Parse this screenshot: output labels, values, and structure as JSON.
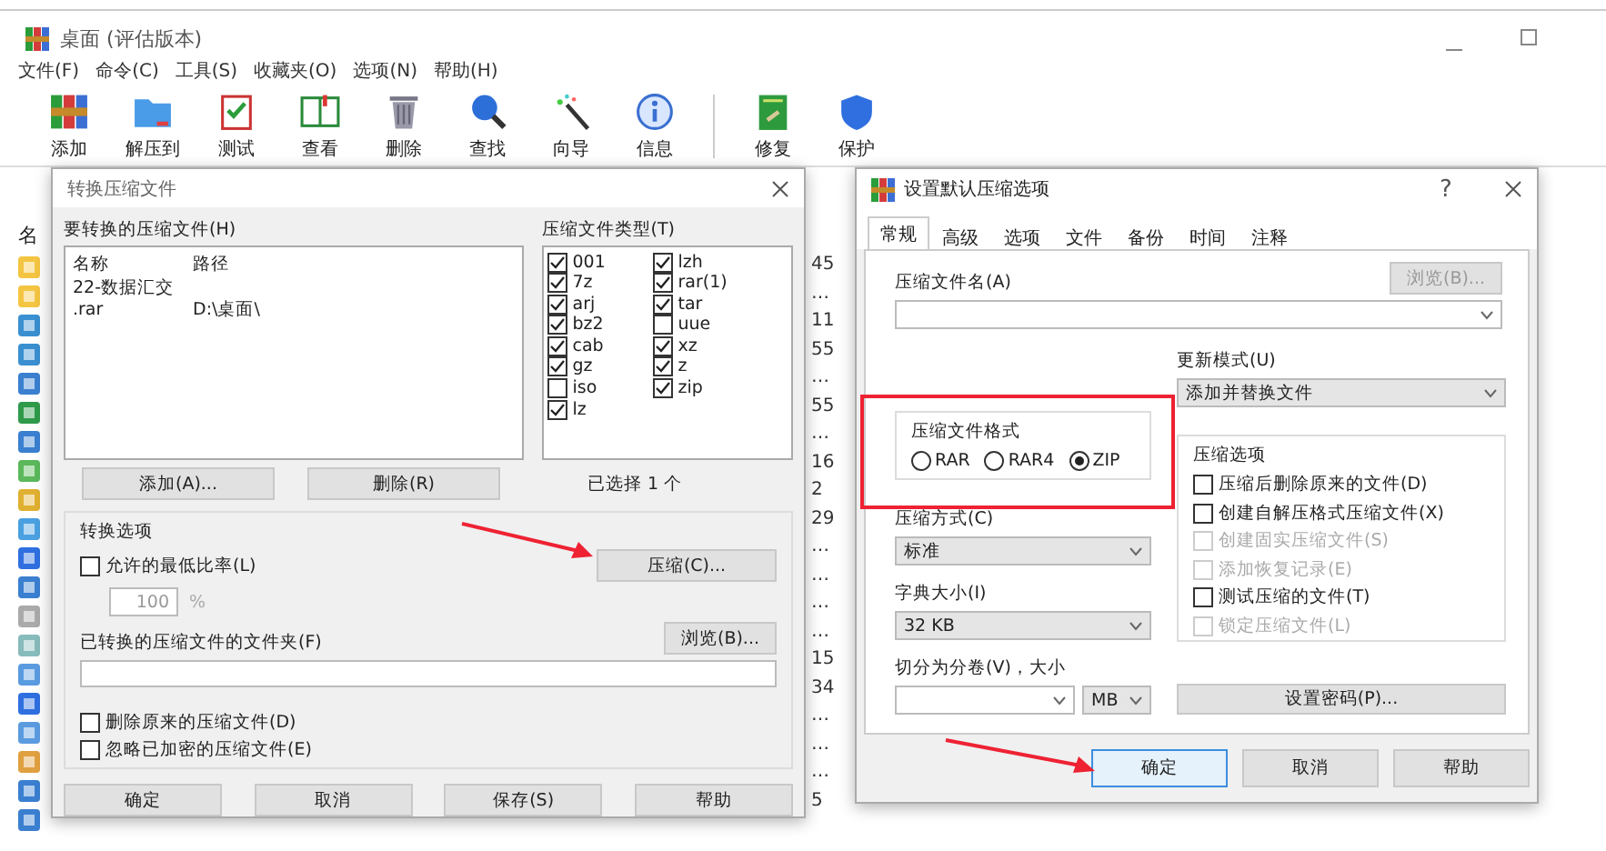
{
  "main_window": {
    "title": "桌面 (评估版本)",
    "menu": [
      "文件(F)",
      "命令(C)",
      "工具(S)",
      "收藏夹(O)",
      "选项(N)",
      "帮助(H)"
    ],
    "toolbar": [
      {
        "label": "添加"
      },
      {
        "label": "解压到"
      },
      {
        "label": "测试"
      },
      {
        "label": "查看"
      },
      {
        "label": "删除"
      },
      {
        "label": "查找"
      },
      {
        "label": "向导"
      },
      {
        "label": "信息"
      },
      {
        "label": "修复"
      },
      {
        "label": "保护"
      }
    ],
    "list_header": "名",
    "column_3": [
      "45",
      "…",
      "11",
      "55",
      "…",
      "55",
      "…",
      "16",
      "2",
      "29",
      "…",
      "…",
      "…",
      "…",
      "15",
      "34",
      "…",
      "…",
      "…",
      "5"
    ]
  },
  "convert_dialog": {
    "title": "转换压缩文件",
    "files_label": "要转换的压缩文件(H)",
    "columns": [
      "名称",
      "路径"
    ],
    "rows": [
      [
        "22-数据汇交 .rar",
        "D:\\桌面\\"
      ]
    ],
    "types_label": "压缩文件类型(T)",
    "types": [
      {
        "label": "001",
        "checked": true
      },
      {
        "label": "7z",
        "checked": true
      },
      {
        "label": "arj",
        "checked": true
      },
      {
        "label": "bz2",
        "checked": true
      },
      {
        "label": "cab",
        "checked": true
      },
      {
        "label": "gz",
        "checked": true
      },
      {
        "label": "iso",
        "checked": false
      },
      {
        "label": "lz",
        "checked": true
      },
      {
        "label": "lzh",
        "checked": true
      },
      {
        "label": "rar(1)",
        "checked": true
      },
      {
        "label": "tar",
        "checked": true
      },
      {
        "label": "uue",
        "checked": false
      },
      {
        "label": "xz",
        "checked": true
      },
      {
        "label": "z",
        "checked": true
      },
      {
        "label": "zip",
        "checked": true
      }
    ],
    "add_button": "添加(A)...",
    "delete_button": "删除(R)",
    "selected_count": "已选择 1 个",
    "options_group": "转换选项",
    "min_ratio": {
      "label": "允许的最低比率(L)",
      "checked": false
    },
    "ratio_value": "100",
    "ratio_unit": "%",
    "compress_button": "压缩(C)...",
    "folder_label": "已转换的压缩文件的文件夹(F)",
    "browse_button": "浏览(B)...",
    "extra_options": [
      {
        "label": "删除原来的压缩文件(D)",
        "checked": false
      },
      {
        "label": "忽略已加密的压缩文件(E)",
        "checked": false
      }
    ],
    "buttons": [
      "确定",
      "取消",
      "保存(S)",
      "帮助"
    ]
  },
  "settings_dialog": {
    "title": "设置默认压缩选项",
    "help": "?",
    "tabs": [
      {
        "label": "常规",
        "selected": true
      },
      {
        "label": "高级",
        "selected": false
      },
      {
        "label": "选项",
        "selected": false
      },
      {
        "label": "文件",
        "selected": false
      },
      {
        "label": "备份",
        "selected": false
      },
      {
        "label": "时间",
        "selected": false
      },
      {
        "label": "注释",
        "selected": false
      }
    ],
    "archive_name_label": "压缩文件名(A)",
    "browse_button": "浏览(B)...",
    "update_label": "更新模式(U)",
    "update_value": "添加并替换文件",
    "format_group": "压缩文件格式",
    "formats": [
      {
        "label": "RAR",
        "selected": false
      },
      {
        "label": "RAR4",
        "selected": false
      },
      {
        "label": "ZIP",
        "selected": true
      }
    ],
    "method_label": "压缩方式(C)",
    "method_value": "标准",
    "dict_label": "字典大小(I)",
    "dict_value": "32 KB",
    "split_label": "切分为分卷(V)，大小",
    "split_unit": "MB",
    "options_group": "压缩选项",
    "options": [
      {
        "label": "压缩后删除原来的文件(D)",
        "checked": false,
        "disabled": false
      },
      {
        "label": "创建自解压格式压缩文件(X)",
        "checked": false,
        "disabled": false
      },
      {
        "label": "创建固实压缩文件(S)",
        "checked": false,
        "disabled": true
      },
      {
        "label": "添加恢复记录(E)",
        "checked": false,
        "disabled": true
      },
      {
        "label": "测试压缩的文件(T)",
        "checked": false,
        "disabled": false
      },
      {
        "label": "锁定压缩文件(L)",
        "checked": false,
        "disabled": true
      }
    ],
    "password_button": "设置密码(P)...",
    "buttons": [
      {
        "label": "确定",
        "selected": true
      },
      {
        "label": "取消",
        "selected": false
      },
      {
        "label": "帮助",
        "selected": false
      }
    ]
  }
}
